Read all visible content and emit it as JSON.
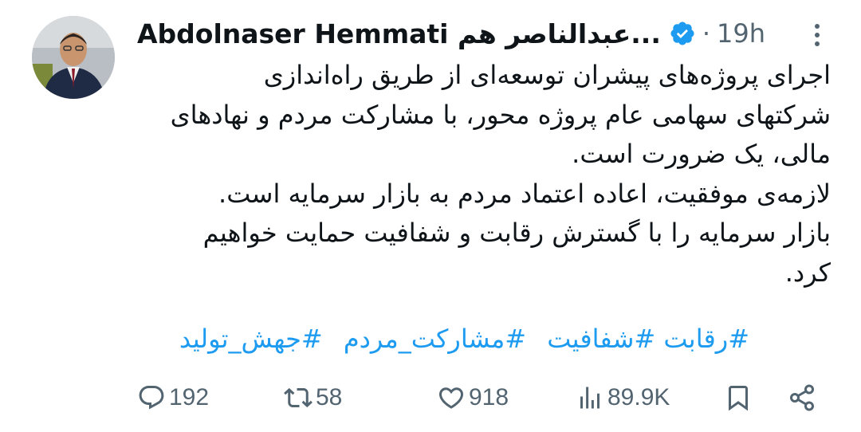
{
  "author": {
    "display_name": "Abdolnaser Hemmati عبدالناصر هم...",
    "verified": true,
    "separator": "·",
    "time": "19h"
  },
  "tweet": {
    "lines": [
      "اجرای پروژه‌های پیشران توسعه‌ای از طریق راه‌اندازی",
      "شرکتهای سهامی عام پروژه محور، با مشارکت مردم و نهادهای",
      "مالی، یک ضرورت است.",
      "لازمه‌ی موفقیت، اعاده اعتماد مردم به بازار سرمایه است.",
      "بازار سرمایه را با گسترش رقابت و شفافیت حمایت خواهیم",
      "کرد."
    ],
    "hashtags": [
      "#رقابت",
      "#شفافیت",
      "#مشارکت_مردم",
      "#جهش_تولید"
    ]
  },
  "actions": {
    "replies": "192",
    "retweets": "58",
    "likes": "918",
    "views": "89.9K"
  },
  "colors": {
    "text": "#0f1419",
    "secondary": "#536471",
    "link": "#1d9bf0",
    "verified": "#1d9bf0"
  },
  "icons": {
    "more": "more-dots-icon",
    "reply": "reply-icon",
    "retweet": "retweet-icon",
    "like": "heart-icon",
    "views": "views-bar-icon",
    "bookmark": "bookmark-icon",
    "share": "share-icon",
    "verified": "verified-badge-icon"
  }
}
